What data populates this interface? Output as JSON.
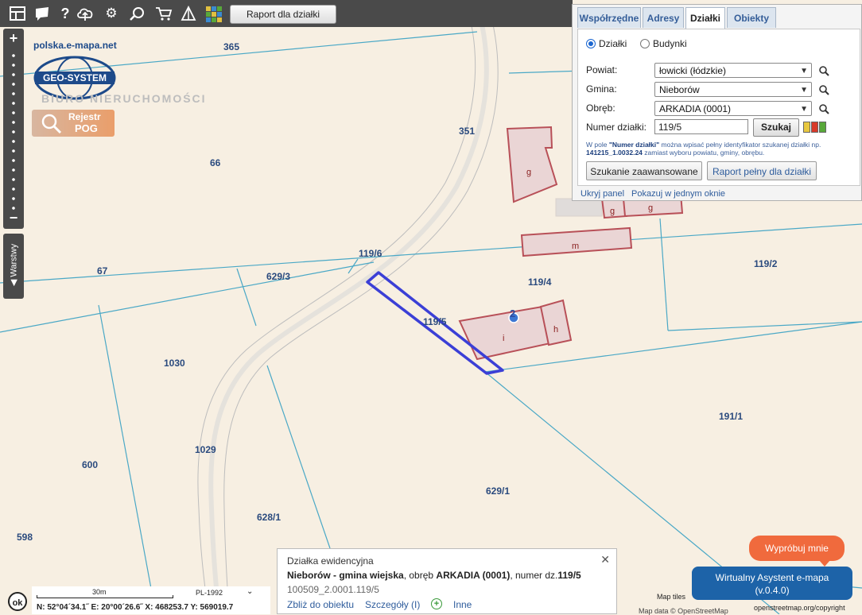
{
  "toolbar": {
    "raport_label": "Raport dla działki",
    "icons": [
      "layout-icon",
      "chat-icon",
      "help-icon",
      "cloud-upload-icon",
      "settings-icon",
      "zoom-icon",
      "cart-icon",
      "shape-icon",
      "color-grid-icon"
    ]
  },
  "zoom": {
    "plus": "+",
    "minus": "−"
  },
  "layers_tab": "◀ Warstwy",
  "branding": {
    "url": "polska.e-mapa.net",
    "logo_text": "GEO-SYSTEM",
    "subtitle": "BIURO NIERUCHOMOŚCI",
    "rejestr_line1": "Rejestr",
    "rejestr_line2": "POG"
  },
  "map": {
    "parcels": [
      "365",
      "351",
      "66",
      "67",
      "629/3",
      "119/6",
      "119/4",
      "119/2",
      "119/5",
      "1030",
      "1029",
      "600",
      "628/1",
      "629/1",
      "598",
      "191/1"
    ],
    "buildings": [
      "g",
      "g",
      "g",
      "m",
      "i",
      "h"
    ],
    "marker": "2"
  },
  "panel": {
    "tabs": [
      "Współrzędne",
      "Adresy",
      "Działki",
      "Obiekty"
    ],
    "active_tab": "Działki",
    "radio_dzialki": "Działki",
    "radio_budynki": "Budynki",
    "powiat_label": "Powiat:",
    "powiat_value": "łowicki (łódzkie)",
    "gmina_label": "Gmina:",
    "gmina_value": "Nieborów",
    "obreb_label": "Obręb:",
    "obreb_value": "ARKADIA (0001)",
    "numer_label": "Numer działki:",
    "numer_value": "119/5",
    "szukaj_label": "Szukaj",
    "hint_pre": "W pole ",
    "hint_field": "\"Numer działki\"",
    "hint_mid": " można wpisać pełny identyfikator szukanej działki np. ",
    "hint_example": "141215_1.0032.24",
    "hint_post": " zamiast wyboru powiatu, gminy, obrębu.",
    "advanced_label": "Szukanie zaawansowane",
    "report_label": "Raport pełny dla działki",
    "hide_link": "Ukryj panel",
    "window_link": "Pokazuj w jednym oknie",
    "swatch_colors": [
      "#e8c840",
      "#d83a2a",
      "#58a83a"
    ]
  },
  "popup": {
    "title": "Działka ewidencyjna",
    "gmina": "Nieborów - gmina wiejska",
    "obreb_pre": ", obręb ",
    "obreb": "ARKADIA (0001)",
    "numer_pre": ", numer dz.",
    "numer": "119/5",
    "id": "100509_2.0001.119/5",
    "link_zoom": "Zbliż do obiektu",
    "link_details": "Szczegóły (I)",
    "link_more": "Inne",
    "close": "✕"
  },
  "scale": {
    "ok": "ok",
    "distance": "30m",
    "projection": "PL-1992",
    "coords": "N: 52°04´34.1˝  E: 20°00´26.6˝  X: 468253.7  Y: 569019.7"
  },
  "assistant": {
    "try_label": "Wypróbuj mnie",
    "title_line1": "Wirtualny Asystent e-mapa",
    "title_line2": "(v.0.4.0)"
  },
  "attribution": {
    "tiles": "Map tiles",
    "osm": "openstreetmap.org/copyright",
    "data": "Map data © OpenStreetMap"
  }
}
